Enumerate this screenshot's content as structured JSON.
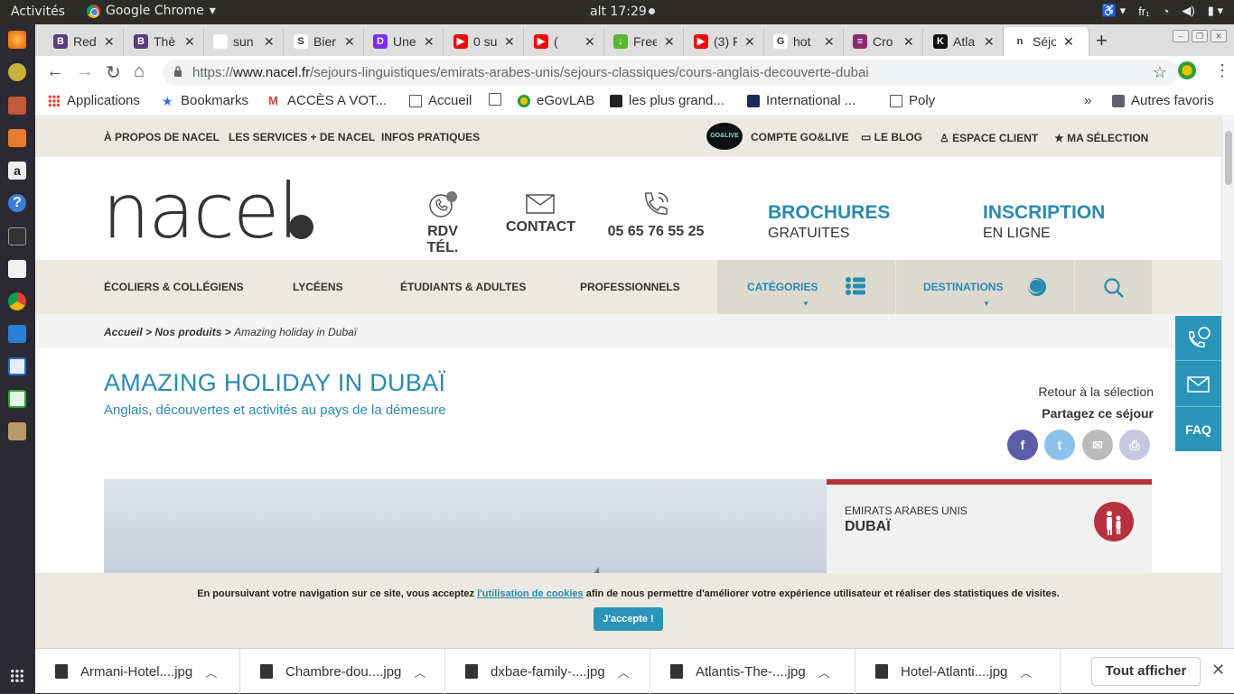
{
  "os": {
    "activities": "Activités",
    "app_name": "Google Chrome",
    "clock": "alt 17:29",
    "lang": "fr₁"
  },
  "tabs": [
    {
      "title": "Red",
      "color": "#563d7c",
      "glyph": "B"
    },
    {
      "title": "Thè",
      "color": "#563d7c",
      "glyph": "B"
    },
    {
      "title": "sun",
      "color": "#ffffff",
      "glyph": ""
    },
    {
      "title": "Bier",
      "color": "#ffffff",
      "glyph": "S"
    },
    {
      "title": "Une",
      "color": "#7b2cf5",
      "glyph": "D"
    },
    {
      "title": "0 su",
      "color": "#ff0000",
      "glyph": "▶"
    },
    {
      "title": "(",
      "color": "#ff0000",
      "glyph": "▶"
    },
    {
      "title": "Free",
      "color": "#5cb531",
      "glyph": "↓"
    },
    {
      "title": "(3) F",
      "color": "#ff0000",
      "glyph": "▶"
    },
    {
      "title": "hot",
      "color": "#ffffff",
      "glyph": "G"
    },
    {
      "title": "Cro",
      "color": "#8b2a6f",
      "glyph": "≡"
    },
    {
      "title": "Atla",
      "color": "#111111",
      "glyph": "K"
    },
    {
      "title": "Séjo",
      "color": "#ffffff",
      "glyph": "n"
    }
  ],
  "address": {
    "scheme": "https://",
    "host": "www.nacel.fr",
    "path": "/sejours-linguistiques/emirats-arabes-unis/sejours-classiques/cours-anglais-decouverte-dubai"
  },
  "bookmarks": [
    {
      "label": "Applications"
    },
    {
      "label": "Bookmarks"
    },
    {
      "label": "ACCÈS A VOT..."
    },
    {
      "label": "Accueil"
    },
    {
      "label": ""
    },
    {
      "label": "eGovLAB"
    },
    {
      "label": "les plus grand..."
    },
    {
      "label": "International ..."
    },
    {
      "label": "Poly"
    }
  ],
  "bookmarks_more": "»",
  "bookmarks_other": "Autres favoris",
  "site": {
    "util_links": [
      "À PROPOS DE NACEL",
      "LES SERVICES + DE NACEL",
      "INFOS PRATIQUES"
    ],
    "util_right": [
      "COMPTE GO&LIVE",
      "LE BLOG",
      "ESPACE CLIENT",
      "MA SÉLECTION"
    ],
    "gologo": "GO&LIVE",
    "logo": "nacel",
    "header_items": [
      "RDV TÉL.",
      "CONTACT",
      "05 65 76 55 25"
    ],
    "brochures": {
      "title": "BROCHURES",
      "sub": "GRATUITES"
    },
    "inscription": {
      "title": "INSCRIPTION",
      "sub": "EN LIGNE"
    },
    "nav": [
      "ÉCOLIERS & COLLÉGIENS",
      "LYCÉENS",
      "ÉTUDIANTS & ADULTES",
      "PROFESSIONNELS"
    ],
    "nav_categories": "CATÉGORIES",
    "nav_destinations": "DESTINATIONS",
    "crumb": {
      "home": "Accueil",
      "sep": " > ",
      "products": "Nos produits",
      "current": "Amazing holiday in Dubaï"
    },
    "title": "AMAZING HOLIDAY IN DUBAÏ",
    "subtitle": "Anglais, découvertes et activités au pays de la démesure",
    "back": "Retour à la sélection",
    "share": "Partagez ce séjour",
    "social": [
      {
        "icon": "facebook-icon",
        "glyph": "f",
        "color": "#5b5ea6"
      },
      {
        "icon": "twitter-icon",
        "glyph": "t",
        "color": "#8cc2ea"
      },
      {
        "icon": "mail-icon",
        "glyph": "✉",
        "color": "#bbbbbb"
      },
      {
        "icon": "print-icon",
        "glyph": "⎙",
        "color": "#c5c8e0"
      }
    ],
    "panel": {
      "country": "EMIRATS ARABES UNIS",
      "city": "DUBAÏ"
    },
    "faq": "FAQ",
    "cookie": {
      "pre": "En poursuivant votre navigation sur ce site, vous acceptez ",
      "link": "l'utilisation de cookies",
      "post": " afin de nous permettre d'améliorer votre expérience utilisateur et réaliser des statistiques de visites.",
      "button": "J'accepte !"
    }
  },
  "downloads": [
    {
      "name": "Armani-Hotel....jpg"
    },
    {
      "name": "Chambre-dou....jpg"
    },
    {
      "name": "dxbae-family-....jpg"
    },
    {
      "name": "Atlantis-The-....jpg"
    },
    {
      "name": "Hotel-Atlanti....jpg"
    }
  ],
  "downloads_show_all": "Tout afficher",
  "colors": {
    "brand_blue": "#2a8ab0",
    "brand_red": "#b5323c",
    "beige": "#ebe9e1"
  }
}
